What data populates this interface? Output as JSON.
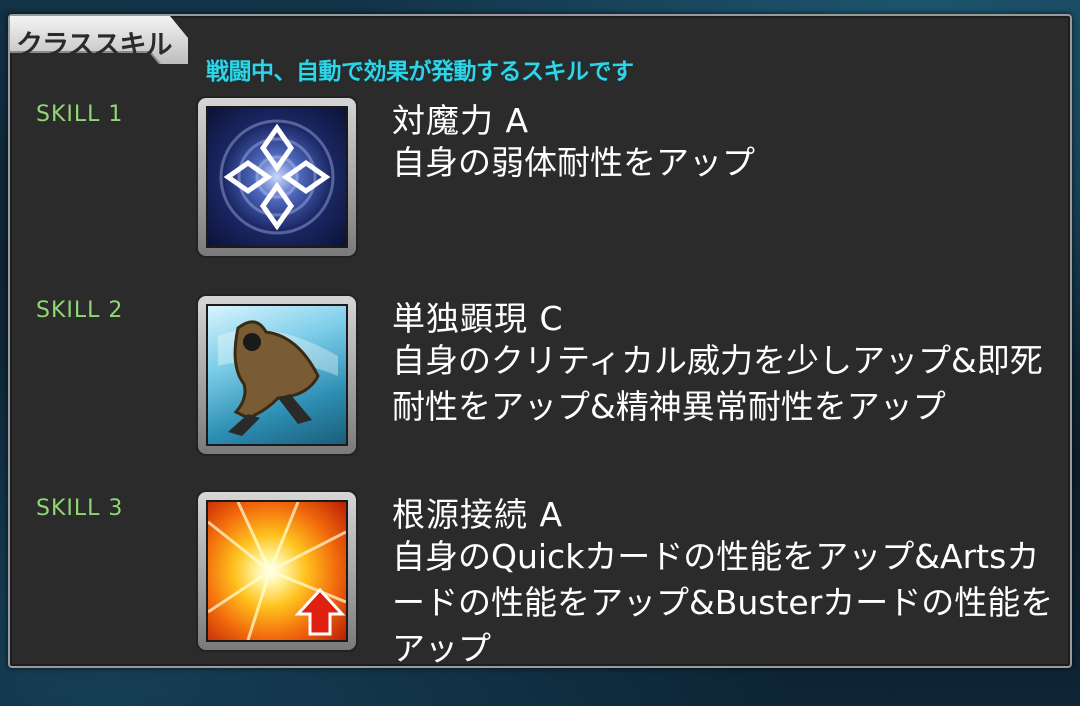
{
  "panel": {
    "title": "クラススキル",
    "subtitle": "戦闘中、自動で効果が発動するスキルです"
  },
  "skills": [
    {
      "label": "SKILL 1",
      "name": "対魔力 A",
      "description": "自身の弱体耐性をアップ",
      "icon": "diamond-rune-icon"
    },
    {
      "label": "SKILL 2",
      "name": "単独顕現 C",
      "description": "自身のクリティカル威力を少しアップ&即死耐性をアップ&精神異常耐性をアップ",
      "icon": "cloaked-figure-icon"
    },
    {
      "label": "SKILL 3",
      "name": "根源接続 A",
      "description": "自身のQuickカードの性能をアップ&Artsカードの性能をアップ&Busterカードの性能をアップ",
      "icon": "burst-up-arrow-icon"
    }
  ],
  "colors": {
    "subtitle": "#2fd4e6",
    "skill_label": "#8fd873",
    "panel_bg": "#2b2b2b",
    "text": "#ffffff"
  }
}
